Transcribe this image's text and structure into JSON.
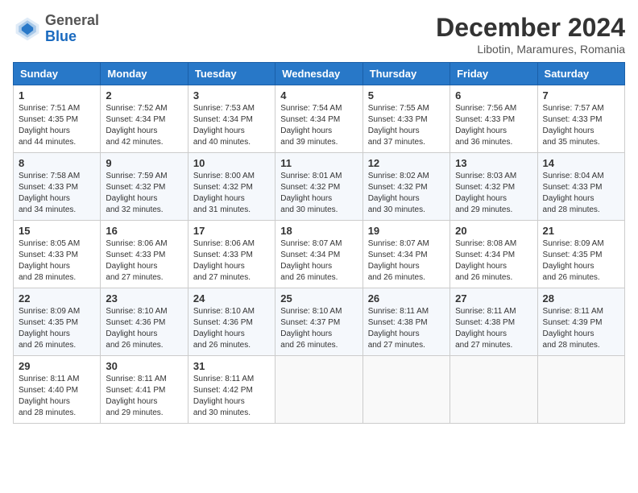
{
  "header": {
    "logo": {
      "general": "General",
      "blue": "Blue"
    },
    "title": "December 2024",
    "location": "Libotin, Maramures, Romania"
  },
  "calendar": {
    "headers": [
      "Sunday",
      "Monday",
      "Tuesday",
      "Wednesday",
      "Thursday",
      "Friday",
      "Saturday"
    ],
    "weeks": [
      [
        {
          "day": "1",
          "sunrise": "7:51 AM",
          "sunset": "4:35 PM",
          "daylight": "8 hours and 44 minutes."
        },
        {
          "day": "2",
          "sunrise": "7:52 AM",
          "sunset": "4:34 PM",
          "daylight": "8 hours and 42 minutes."
        },
        {
          "day": "3",
          "sunrise": "7:53 AM",
          "sunset": "4:34 PM",
          "daylight": "8 hours and 40 minutes."
        },
        {
          "day": "4",
          "sunrise": "7:54 AM",
          "sunset": "4:34 PM",
          "daylight": "8 hours and 39 minutes."
        },
        {
          "day": "5",
          "sunrise": "7:55 AM",
          "sunset": "4:33 PM",
          "daylight": "8 hours and 37 minutes."
        },
        {
          "day": "6",
          "sunrise": "7:56 AM",
          "sunset": "4:33 PM",
          "daylight": "8 hours and 36 minutes."
        },
        {
          "day": "7",
          "sunrise": "7:57 AM",
          "sunset": "4:33 PM",
          "daylight": "8 hours and 35 minutes."
        }
      ],
      [
        {
          "day": "8",
          "sunrise": "7:58 AM",
          "sunset": "4:33 PM",
          "daylight": "8 hours and 34 minutes."
        },
        {
          "day": "9",
          "sunrise": "7:59 AM",
          "sunset": "4:32 PM",
          "daylight": "8 hours and 32 minutes."
        },
        {
          "day": "10",
          "sunrise": "8:00 AM",
          "sunset": "4:32 PM",
          "daylight": "8 hours and 31 minutes."
        },
        {
          "day": "11",
          "sunrise": "8:01 AM",
          "sunset": "4:32 PM",
          "daylight": "8 hours and 30 minutes."
        },
        {
          "day": "12",
          "sunrise": "8:02 AM",
          "sunset": "4:32 PM",
          "daylight": "8 hours and 30 minutes."
        },
        {
          "day": "13",
          "sunrise": "8:03 AM",
          "sunset": "4:32 PM",
          "daylight": "8 hours and 29 minutes."
        },
        {
          "day": "14",
          "sunrise": "8:04 AM",
          "sunset": "4:33 PM",
          "daylight": "8 hours and 28 minutes."
        }
      ],
      [
        {
          "day": "15",
          "sunrise": "8:05 AM",
          "sunset": "4:33 PM",
          "daylight": "8 hours and 28 minutes."
        },
        {
          "day": "16",
          "sunrise": "8:06 AM",
          "sunset": "4:33 PM",
          "daylight": "8 hours and 27 minutes."
        },
        {
          "day": "17",
          "sunrise": "8:06 AM",
          "sunset": "4:33 PM",
          "daylight": "8 hours and 27 minutes."
        },
        {
          "day": "18",
          "sunrise": "8:07 AM",
          "sunset": "4:34 PM",
          "daylight": "8 hours and 26 minutes."
        },
        {
          "day": "19",
          "sunrise": "8:07 AM",
          "sunset": "4:34 PM",
          "daylight": "8 hours and 26 minutes."
        },
        {
          "day": "20",
          "sunrise": "8:08 AM",
          "sunset": "4:34 PM",
          "daylight": "8 hours and 26 minutes."
        },
        {
          "day": "21",
          "sunrise": "8:09 AM",
          "sunset": "4:35 PM",
          "daylight": "8 hours and 26 minutes."
        }
      ],
      [
        {
          "day": "22",
          "sunrise": "8:09 AM",
          "sunset": "4:35 PM",
          "daylight": "8 hours and 26 minutes."
        },
        {
          "day": "23",
          "sunrise": "8:10 AM",
          "sunset": "4:36 PM",
          "daylight": "8 hours and 26 minutes."
        },
        {
          "day": "24",
          "sunrise": "8:10 AM",
          "sunset": "4:36 PM",
          "daylight": "8 hours and 26 minutes."
        },
        {
          "day": "25",
          "sunrise": "8:10 AM",
          "sunset": "4:37 PM",
          "daylight": "8 hours and 26 minutes."
        },
        {
          "day": "26",
          "sunrise": "8:11 AM",
          "sunset": "4:38 PM",
          "daylight": "8 hours and 27 minutes."
        },
        {
          "day": "27",
          "sunrise": "8:11 AM",
          "sunset": "4:38 PM",
          "daylight": "8 hours and 27 minutes."
        },
        {
          "day": "28",
          "sunrise": "8:11 AM",
          "sunset": "4:39 PM",
          "daylight": "8 hours and 28 minutes."
        }
      ],
      [
        {
          "day": "29",
          "sunrise": "8:11 AM",
          "sunset": "4:40 PM",
          "daylight": "8 hours and 28 minutes."
        },
        {
          "day": "30",
          "sunrise": "8:11 AM",
          "sunset": "4:41 PM",
          "daylight": "8 hours and 29 minutes."
        },
        {
          "day": "31",
          "sunrise": "8:11 AM",
          "sunset": "4:42 PM",
          "daylight": "8 hours and 30 minutes."
        },
        null,
        null,
        null,
        null
      ]
    ]
  }
}
